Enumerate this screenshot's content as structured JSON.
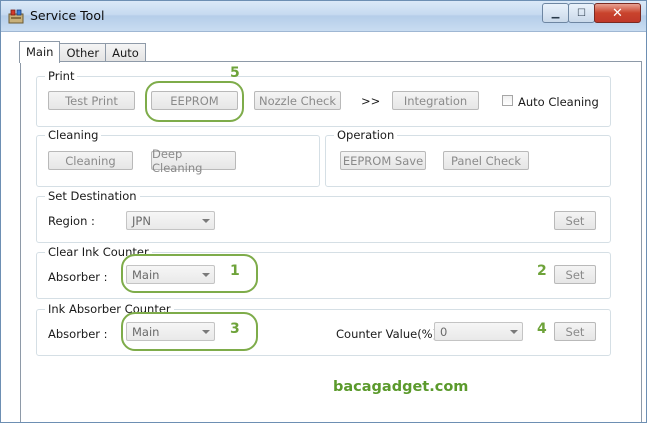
{
  "window": {
    "title": "Service Tool"
  },
  "tabs": [
    {
      "label": "Main"
    },
    {
      "label": "Other"
    },
    {
      "label": "Auto"
    }
  ],
  "print_group": {
    "label": "Print",
    "buttons": {
      "test_print": "Test Print",
      "eeprom": "EEPROM",
      "nozzle_check": "Nozzle Check",
      "integration": "Integration"
    },
    "arrow_text": ">>",
    "auto_cleaning_label": "Auto Cleaning",
    "auto_cleaning_checked": false
  },
  "cleaning_group": {
    "label": "Cleaning",
    "buttons": {
      "cleaning": "Cleaning",
      "deep_cleaning": "Deep Cleaning"
    }
  },
  "operation_group": {
    "label": "Operation",
    "buttons": {
      "eeprom_save": "EEPROM Save",
      "panel_check": "Panel Check"
    }
  },
  "set_destination": {
    "label": "Set Destination",
    "region_label": "Region :",
    "region_value": "JPN",
    "set_label": "Set"
  },
  "clear_ink_counter": {
    "label": "Clear Ink Counter",
    "absorber_label": "Absorber :",
    "absorber_value": "Main",
    "set_label": "Set"
  },
  "ink_absorber_counter": {
    "label": "Ink Absorber Counter",
    "absorber_label": "Absorber :",
    "absorber_value": "Main",
    "counter_label": "Counter Value(%) :",
    "counter_value": "0",
    "set_label": "Set"
  },
  "annotations": {
    "n1": "1",
    "n2": "2",
    "n3": "3",
    "n4": "4",
    "n5": "5",
    "color": "#6ea33a"
  },
  "watermark": "bacagadget.com"
}
